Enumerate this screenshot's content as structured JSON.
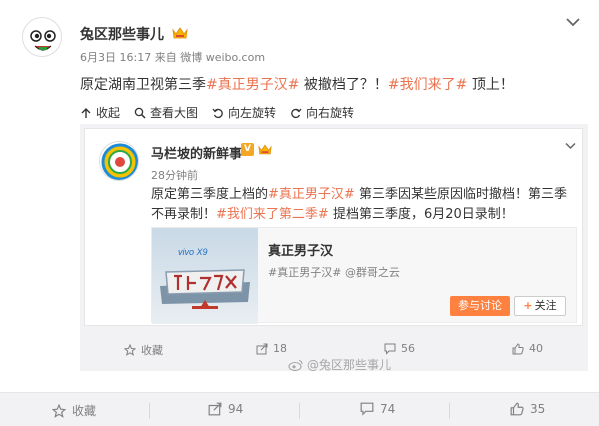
{
  "post": {
    "author": "兔区那些事儿",
    "date": "6月3日 16:17",
    "via_prefix": "来自",
    "source": "微博 weibo.com",
    "text_plain_1": "原定湖南卫视第三季",
    "topic_1": "#真正男子汉#",
    "text_plain_2": " 被撤档了？！",
    "topic_2": "#我们来了#",
    "text_plain_3": " 顶上！"
  },
  "image_toolbar": {
    "collapse": "收起",
    "view_large": "查看大图",
    "rotate_left": "向左旋转",
    "rotate_right": "向右旋转"
  },
  "repost": {
    "author": "马栏坡的新鲜事",
    "v_badge": "V",
    "time": "28分钟前",
    "text_1": "原定第三季度上档的",
    "topic_1": "#真正男子汉#",
    "text_2": " 第三季因某些原因临时撤档！第三季不再录制！",
    "topic_2": "#我们来了第二季#",
    "text_3": " 提档第三季度，6月20日录制！",
    "link_card": {
      "title": "真正男子汉",
      "subtitle_topic": "#真正男子汉#",
      "subtitle_user": "@群哥之云",
      "join_label": "参与讨论",
      "follow_label": "关注",
      "image_brand": "vivo X9"
    },
    "actions": {
      "favorite": "收藏",
      "repost_count": "18",
      "comment_count": "56",
      "like_count": "40"
    }
  },
  "watermark": "@兔区那些事儿",
  "main_actions": {
    "favorite": "收藏",
    "repost_count": "94",
    "comment_count": "74",
    "like_count": "35"
  },
  "colors": {
    "topic": "#eb7350",
    "accent": "#ff8140",
    "muted": "#808080",
    "panel_bg": "#f2f2f5"
  }
}
